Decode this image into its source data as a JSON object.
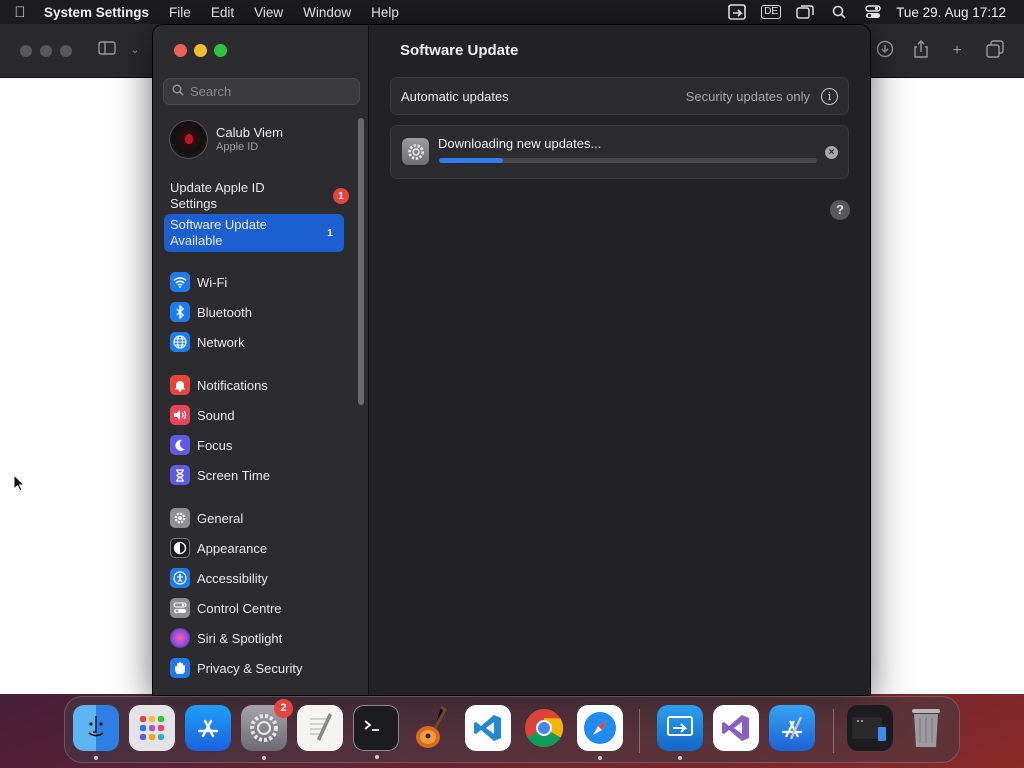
{
  "menubar": {
    "app_name": "System Settings",
    "items": [
      "File",
      "Edit",
      "View",
      "Window",
      "Help"
    ],
    "keyboard_layout": "DE",
    "clock": "Tue 29. Aug  17:12"
  },
  "sidebar": {
    "search_placeholder": "Search",
    "account": {
      "name": "Calub Viem",
      "subtitle": "Apple ID"
    },
    "notices": [
      {
        "label": "Update Apple ID Settings",
        "badge": "1"
      },
      {
        "label": "Software Update Available",
        "badge": "1",
        "selected": true
      }
    ],
    "items": [
      {
        "label": "Wi-Fi",
        "icon": "wifi-icon",
        "color": "#1e7cf2"
      },
      {
        "label": "Bluetooth",
        "icon": "bluetooth-icon",
        "color": "#1e7cf2"
      },
      {
        "label": "Network",
        "icon": "globe-icon",
        "color": "#1e7cf2"
      },
      {
        "label": "Notifications",
        "icon": "bell-icon",
        "color": "#e9443c"
      },
      {
        "label": "Sound",
        "icon": "speaker-icon",
        "color": "#e9445e"
      },
      {
        "label": "Focus",
        "icon": "moon-icon",
        "color": "#5e5ce6"
      },
      {
        "label": "Screen Time",
        "icon": "hourglass-icon",
        "color": "#5e5ce6"
      },
      {
        "label": "General",
        "icon": "gear-icon",
        "color": "#8e8e93"
      },
      {
        "label": "Appearance",
        "icon": "appearance-icon",
        "color": "#1c1c1e"
      },
      {
        "label": "Accessibility",
        "icon": "accessibility-icon",
        "color": "#1e7cf2"
      },
      {
        "label": "Control Centre",
        "icon": "toggles-icon",
        "color": "#8e8e93"
      },
      {
        "label": "Siri & Spotlight",
        "icon": "siri-icon",
        "color": "#b84fd8"
      },
      {
        "label": "Privacy & Security",
        "icon": "hand-icon",
        "color": "#1e7cf2"
      }
    ]
  },
  "main": {
    "title": "Software Update",
    "automatic_updates": {
      "label": "Automatic updates",
      "value": "Security updates only"
    },
    "download": {
      "label": "Downloading new updates...",
      "progress": 0.17
    }
  },
  "dock": {
    "apps": [
      {
        "name": "finder"
      },
      {
        "name": "launchpad"
      },
      {
        "name": "app-store"
      },
      {
        "name": "system-settings",
        "badge": "2"
      },
      {
        "name": "textedit"
      },
      {
        "name": "terminal"
      },
      {
        "name": "garageband"
      },
      {
        "name": "vscode"
      },
      {
        "name": "chrome"
      },
      {
        "name": "safari"
      },
      {
        "name": "remote-desktop"
      },
      {
        "name": "visual-studio"
      },
      {
        "name": "xcode-instruments"
      },
      {
        "name": "screen-shot"
      },
      {
        "name": "trash"
      }
    ]
  }
}
